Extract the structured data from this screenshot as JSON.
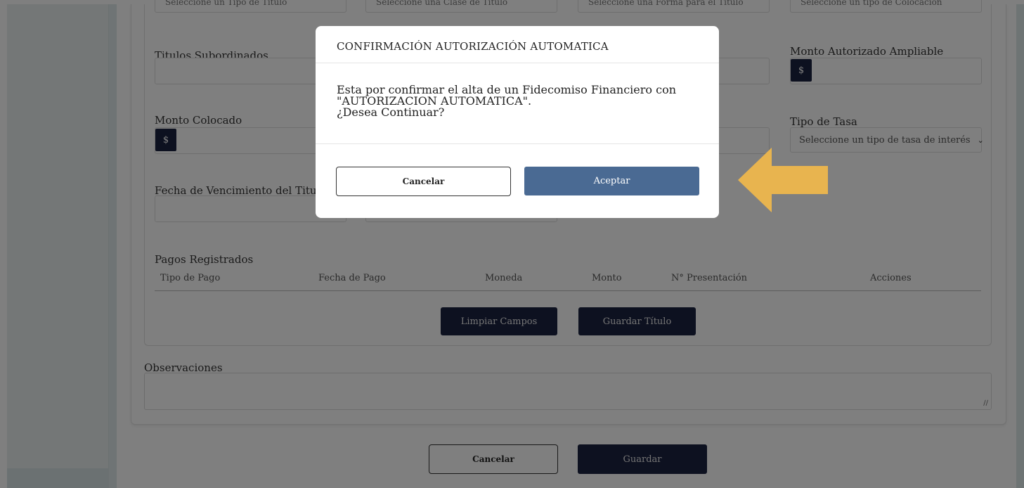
{
  "form": {
    "top_row_placeholders": [
      "Seleccione un Tipo de Título",
      "Seleccione una Clase de Título",
      "Seleccione una Forma para el Título",
      "Seleccione un tipo de Colocación"
    ],
    "titulos_subordinados_label": "Titulos Subordinados",
    "monto_autorizado_ampliable_label": "Monto Autorizado Ampliable",
    "monto_colocado_label": "Monto Colocado",
    "tipo_de_tasa_label": "Tipo de Tasa",
    "tipo_de_tasa_selected": "Seleccione un tipo de tasa de interés",
    "fecha_vencimiento_label": "Fecha de Vencimiento del Titulo",
    "currency_symbol": "$"
  },
  "payments": {
    "title": "Pagos Registrados",
    "columns": [
      "Tipo de Pago",
      "Fecha de Pago",
      "Moneda",
      "Monto",
      "N° Presentación",
      "Acciones"
    ]
  },
  "actions": {
    "clear_label": "Limpiar Campos",
    "save_title_label": "Guardar Título"
  },
  "observations": {
    "label": "Observaciones"
  },
  "footer": {
    "cancel_label": "Cancelar",
    "save_label": "Guardar"
  },
  "modal": {
    "title": "CONFIRMACIÓN AUTORIZACIÓN AUTOMATICA",
    "body_lines": [
      "Esta por confirmar el alta de un Fidecomiso Financiero con",
      "\"AUTORIZACION AUTOMATICA\".",
      "¿Desea Continuar?"
    ],
    "cancel_label": "Cancelar",
    "accept_label": "Aceptar"
  },
  "colors": {
    "navy": "#1a2240",
    "accept_blue": "#4a6a93",
    "arrow": "#e8b44f"
  },
  "icons": {
    "select_chevron": "chevron-down-icon",
    "annotation_arrow": "left-arrow-icon",
    "textarea_grip": "resize-grip-icon"
  }
}
